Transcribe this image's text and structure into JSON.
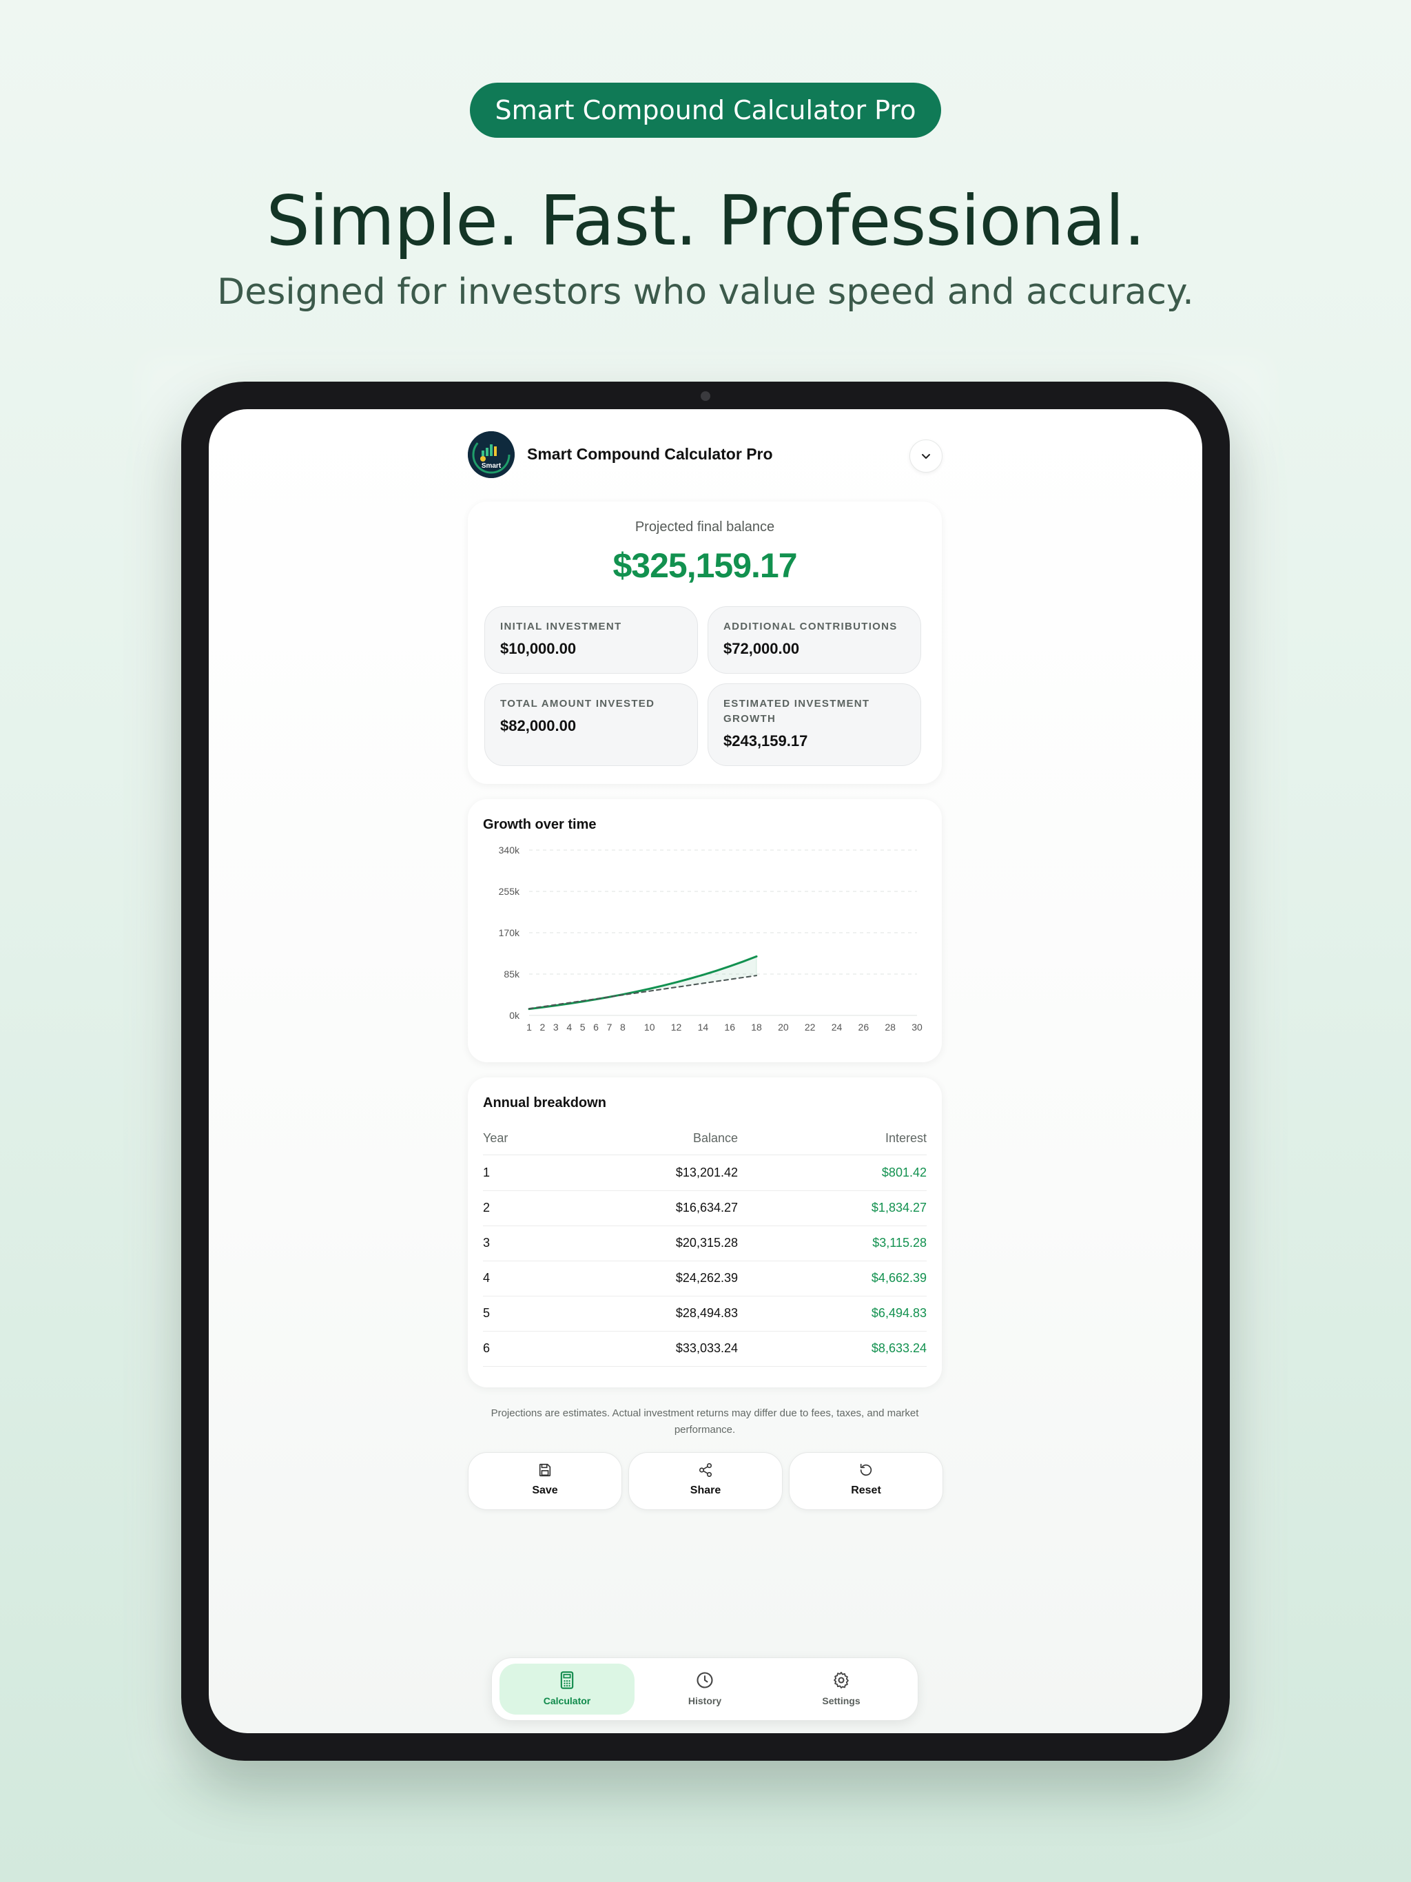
{
  "banner": {
    "app_name": "Smart Compound Calculator Pro",
    "headline": "Simple. Fast. Professional.",
    "subheadline": "Designed for investors who value speed and accuracy."
  },
  "header": {
    "logo_text": "Smart",
    "title": "Smart Compound Calculator Pro"
  },
  "summary": {
    "projected_label": "Projected final balance",
    "projected_value": "$325,159.17",
    "stats": [
      {
        "label": "INITIAL INVESTMENT",
        "value": "$10,000.00"
      },
      {
        "label": "ADDITIONAL CONTRIBUTIONS",
        "value": "$72,000.00"
      },
      {
        "label": "TOTAL AMOUNT INVESTED",
        "value": "$82,000.00"
      },
      {
        "label": "ESTIMATED INVESTMENT GROWTH",
        "value": "$243,159.17"
      }
    ]
  },
  "chart": {
    "title": "Growth over time"
  },
  "chart_data": {
    "type": "line",
    "title": "Growth over time",
    "xlabel": "",
    "ylabel": "",
    "y_ticks": [
      "0k",
      "85k",
      "170k",
      "255k",
      "340k"
    ],
    "x_ticks": [
      "1",
      "2",
      "3",
      "4",
      "5",
      "6",
      "7",
      "8",
      "10",
      "12",
      "14",
      "16",
      "18",
      "20",
      "22",
      "24",
      "26",
      "28",
      "30"
    ],
    "xlim": [
      1,
      30
    ],
    "ylim": [
      0,
      340000
    ],
    "grid": true,
    "legend": "none",
    "x": [
      1,
      2,
      3,
      4,
      5,
      6,
      7,
      8,
      9,
      10,
      11,
      12,
      13,
      14,
      15,
      16,
      17,
      18
    ],
    "series": [
      {
        "values": [
          13201,
          16634,
          20315,
          24262,
          28495,
          33033,
          37900,
          43120,
          48710,
          54710,
          61140,
          68040,
          75440,
          83370,
          91880,
          101000,
          110780,
          121270
        ],
        "color": "#129150",
        "style": "solid",
        "fill_to_next": true
      },
      {
        "values": [
          14000,
          18000,
          22000,
          26000,
          30000,
          34000,
          38000,
          42000,
          46000,
          50000,
          54000,
          58000,
          62000,
          66000,
          70000,
          74000,
          78000,
          82000
        ],
        "color": "#4a5553",
        "style": "dashed"
      }
    ]
  },
  "breakdown": {
    "title": "Annual breakdown",
    "columns": {
      "year": "Year",
      "balance": "Balance",
      "interest": "Interest"
    },
    "rows": [
      {
        "year": "1",
        "balance": "$13,201.42",
        "interest": "$801.42"
      },
      {
        "year": "2",
        "balance": "$16,634.27",
        "interest": "$1,834.27"
      },
      {
        "year": "3",
        "balance": "$20,315.28",
        "interest": "$3,115.28"
      },
      {
        "year": "4",
        "balance": "$24,262.39",
        "interest": "$4,662.39"
      },
      {
        "year": "5",
        "balance": "$28,494.83",
        "interest": "$6,494.83"
      },
      {
        "year": "6",
        "balance": "$33,033.24",
        "interest": "$8,633.24"
      }
    ]
  },
  "disclaimer": "Projections are estimates. Actual investment returns may differ due to fees, taxes, and market performance.",
  "actions": {
    "save": "Save",
    "share": "Share",
    "reset": "Reset"
  },
  "tabs": {
    "calculator": "Calculator",
    "history": "History",
    "settings": "Settings"
  },
  "colors": {
    "brand": "#107a56",
    "accent": "#12914f",
    "active_tab_bg": "#dcf6e4"
  }
}
